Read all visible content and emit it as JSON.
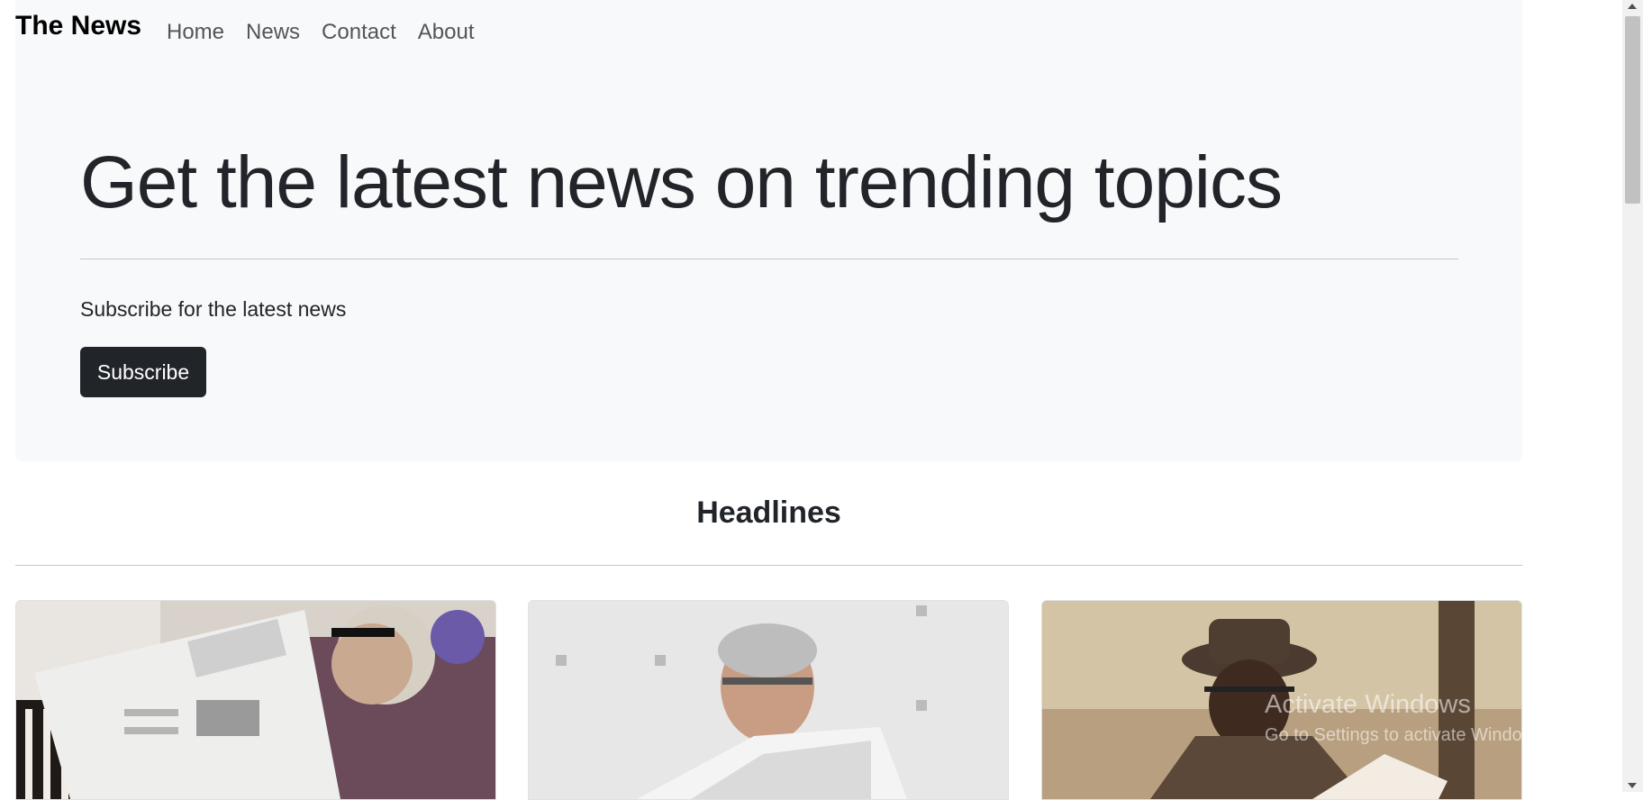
{
  "navbar": {
    "brand": "The News",
    "links": [
      "Home",
      "News",
      "Contact",
      "About"
    ]
  },
  "hero": {
    "title": "Get the latest news on trending topics",
    "text": "Subscribe for the latest news",
    "button_label": "Subscribe"
  },
  "headlines": {
    "title": "Headlines",
    "cards": [
      {
        "image": "man-reading-newspaper-photo"
      },
      {
        "image": "man-with-glasses-reading-newspaper-photo"
      },
      {
        "image": "man-in-hat-reading-newspaper-photo"
      }
    ]
  },
  "watermark": {
    "title": "Activate Windows",
    "subtitle": "Go to Settings to activate Windows."
  },
  "colors": {
    "hero_bg": "#f8f9fa",
    "button_bg": "#212529",
    "text": "#212529"
  }
}
